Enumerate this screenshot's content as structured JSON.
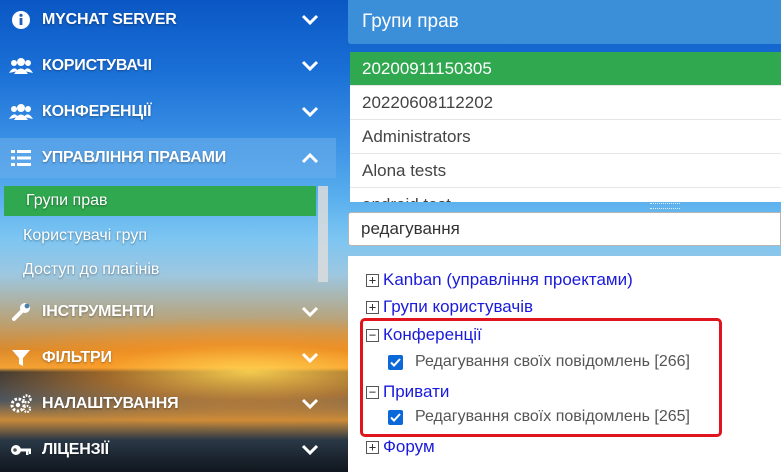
{
  "sidebar": {
    "items": [
      {
        "label": "MYCHAT SERVER",
        "icon": "info-circle-icon"
      },
      {
        "label": "КОРИСТУВАЧІ",
        "icon": "users-icon"
      },
      {
        "label": "КОНФЕРЕНЦІЇ",
        "icon": "users-icon"
      },
      {
        "label": "УПРАВЛІННЯ ПРАВАМИ",
        "icon": "list-icon"
      },
      {
        "label": "ІНСТРУМЕНТИ",
        "icon": "wrench-icon"
      },
      {
        "label": "ФІЛЬТРИ",
        "icon": "filter-icon"
      },
      {
        "label": "НАЛАШТУВАННЯ",
        "icon": "cogs-icon"
      },
      {
        "label": "ЛІЦЕНЗІЇ",
        "icon": "key-icon"
      }
    ],
    "subitems": [
      {
        "label": "Групи прав"
      },
      {
        "label": "Користувачі груп"
      },
      {
        "label": "Доступ до плагінів"
      }
    ]
  },
  "panel": {
    "title": "Групи прав",
    "groups": [
      "20200911150305",
      "20220608112202",
      "Administrators",
      "Alona tests",
      "android test"
    ]
  },
  "search": {
    "value": "редагування"
  },
  "tree": {
    "nodes": [
      {
        "label": "Kanban (управління проектами)",
        "toggle": "+"
      },
      {
        "label": "Групи користувачів",
        "toggle": "+"
      },
      {
        "label": "Конференції",
        "toggle": "−"
      },
      {
        "label": "Редагування своїх повідомлень [266]"
      },
      {
        "label": "Привати",
        "toggle": "−"
      },
      {
        "label": "Редагування своїх повідомлень [265]"
      },
      {
        "label": "Форум",
        "toggle": "+"
      }
    ]
  },
  "colors": {
    "accent": "#3b8fd8",
    "selected": "#2fa84f",
    "highlight": "#e0141c",
    "link": "#1a1adb"
  }
}
